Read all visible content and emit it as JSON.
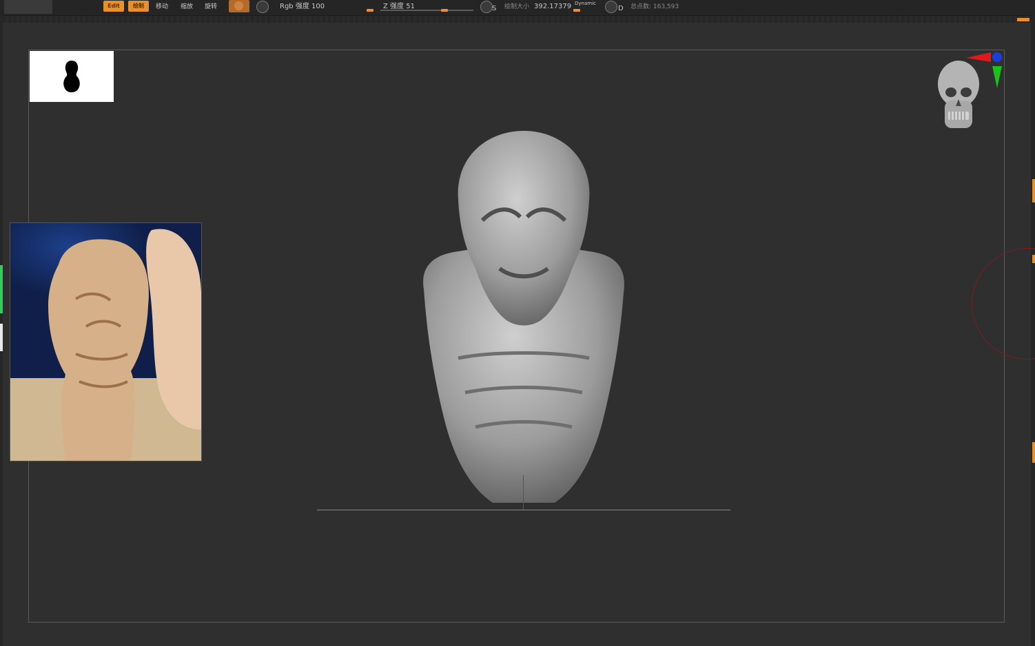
{
  "toolbar": {
    "menu_left": "",
    "menu_left2": "",
    "rgb_label": "Rgb 强度 100",
    "z_intensity": "Z 强度 51",
    "draw_size_label": "绘制大小",
    "draw_size_value": "392.17379",
    "dynamic_label": "Dynamic",
    "s_label": "S",
    "d_label": "D",
    "total_points": "总点数: 163,593",
    "btn_edit": "Edit",
    "btn_draw": "绘制",
    "btn_move": "移动",
    "btn_scale": "缩放",
    "btn_rotate": "旋转"
  },
  "colors": {
    "accent": "#e8912c",
    "canvas_bg": "#2f2f2f",
    "toolbar_bg": "#252525",
    "axis_red": "#e01a1a",
    "axis_green": "#19c219",
    "axis_blue": "#1a3fe0"
  },
  "icons": {
    "silhouette": "person-silhouette-icon",
    "navigator": "skull-navigator-icon",
    "gizmo": "axis-gizmo-icon"
  }
}
